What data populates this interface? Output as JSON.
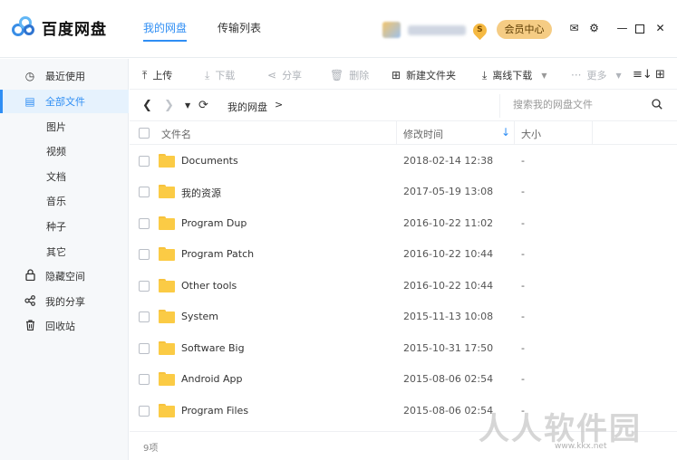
{
  "app": {
    "name": "百度网盘"
  },
  "topnav": [
    {
      "label": "我的网盘",
      "active": true
    },
    {
      "label": "传输列表",
      "active": false
    }
  ],
  "user": {
    "coin_glyph": "S"
  },
  "vip_label": "会员中心",
  "sidebar": {
    "items": [
      {
        "label": "最近使用",
        "icon": "clock-icon",
        "glyph": "◷"
      },
      {
        "label": "全部文件",
        "icon": "document-icon",
        "glyph": "▤",
        "active": true
      },
      {
        "label": "图片",
        "sub": true
      },
      {
        "label": "视频",
        "sub": true
      },
      {
        "label": "文档",
        "sub": true
      },
      {
        "label": "音乐",
        "sub": true
      },
      {
        "label": "种子",
        "sub": true
      },
      {
        "label": "其它",
        "sub": true
      },
      {
        "label": "隐藏空间",
        "icon": "lock-icon",
        "glyph": "🔒"
      },
      {
        "label": "我的分享",
        "icon": "share-icon",
        "glyph": "⋘"
      },
      {
        "label": "回收站",
        "icon": "trash-icon",
        "glyph": "🗑"
      }
    ]
  },
  "toolbar": {
    "upload": "上传",
    "download": "下载",
    "share": "分享",
    "delete": "删除",
    "new_folder": "新建文件夹",
    "offline_download": "离线下载",
    "more": "更多"
  },
  "pathbar": {
    "crumb": "我的网盘",
    "separator": ">",
    "search_placeholder": "搜索我的网盘文件"
  },
  "table": {
    "headers": {
      "name": "文件名",
      "mtime": "修改时间",
      "size": "大小"
    },
    "rows": [
      {
        "name": "Documents",
        "mtime": "2018-02-14 12:38",
        "size": "-"
      },
      {
        "name": "我的资源",
        "mtime": "2017-05-19 13:08",
        "size": "-"
      },
      {
        "name": "Program Dup",
        "mtime": "2016-10-22 11:02",
        "size": "-"
      },
      {
        "name": "Program Patch",
        "mtime": "2016-10-22 10:44",
        "size": "-"
      },
      {
        "name": "Other tools",
        "mtime": "2016-10-22 10:44",
        "size": "-"
      },
      {
        "name": "System",
        "mtime": "2015-11-13 10:08",
        "size": "-"
      },
      {
        "name": "Software Big",
        "mtime": "2015-10-31 17:50",
        "size": "-"
      },
      {
        "name": "Android App",
        "mtime": "2015-08-06 02:54",
        "size": "-"
      },
      {
        "name": "Program Files",
        "mtime": "2015-08-06 02:54",
        "size": "-"
      }
    ]
  },
  "footer": {
    "count": "9项"
  },
  "watermark": {
    "text": "人人软件园",
    "sub": "www.kkx.net"
  },
  "colors": {
    "accent": "#2f8ef4",
    "folder": "#fbcb45",
    "vip": "#f5cc84"
  }
}
